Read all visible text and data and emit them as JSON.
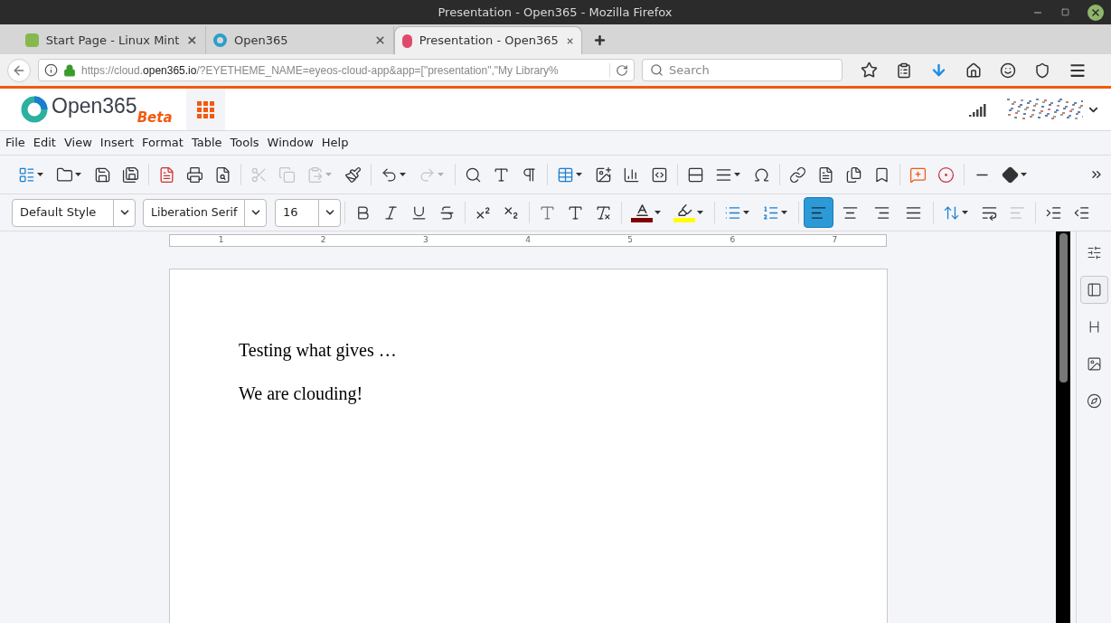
{
  "window": {
    "title": "Presentation - Open365 - Mozilla Firefox"
  },
  "tabs": [
    {
      "label": "Start Page - Linux Mint",
      "selected": false
    },
    {
      "label": "Open365",
      "selected": false
    },
    {
      "label": "Presentation - Open365",
      "selected": true
    }
  ],
  "address_bar": {
    "url_prefix": "https://cloud.",
    "url_domain": "open365.io",
    "url_suffix": "/?EYETHEME_NAME=eyeos-cloud-app&app=[\"presentation\",\"My Library%"
  },
  "search": {
    "placeholder": "Search"
  },
  "app_header": {
    "logo": "Open365",
    "badge": "Beta"
  },
  "menu": [
    "File",
    "Edit",
    "View",
    "Insert",
    "Format",
    "Table",
    "Tools",
    "Window",
    "Help"
  ],
  "formatting": {
    "style": "Default Style",
    "font": "Liberation Serif",
    "size": "16",
    "alignment": [
      {
        "kind": "left",
        "selected": true
      },
      {
        "kind": "center",
        "selected": false
      },
      {
        "kind": "right",
        "selected": false
      },
      {
        "kind": "justify",
        "selected": false
      }
    ]
  },
  "ruler": [
    "1",
    "2",
    "3",
    "4",
    "5",
    "6",
    "7"
  ],
  "document": {
    "paragraphs": [
      "Testing what gives …",
      "We are clouding!"
    ]
  },
  "sidebar": [
    {
      "kind": "properties",
      "selected": false
    },
    {
      "kind": "page",
      "selected": true
    },
    {
      "kind": "styles",
      "selected": false
    },
    {
      "kind": "gallery",
      "selected": false
    },
    {
      "kind": "navigator",
      "selected": false
    }
  ]
}
